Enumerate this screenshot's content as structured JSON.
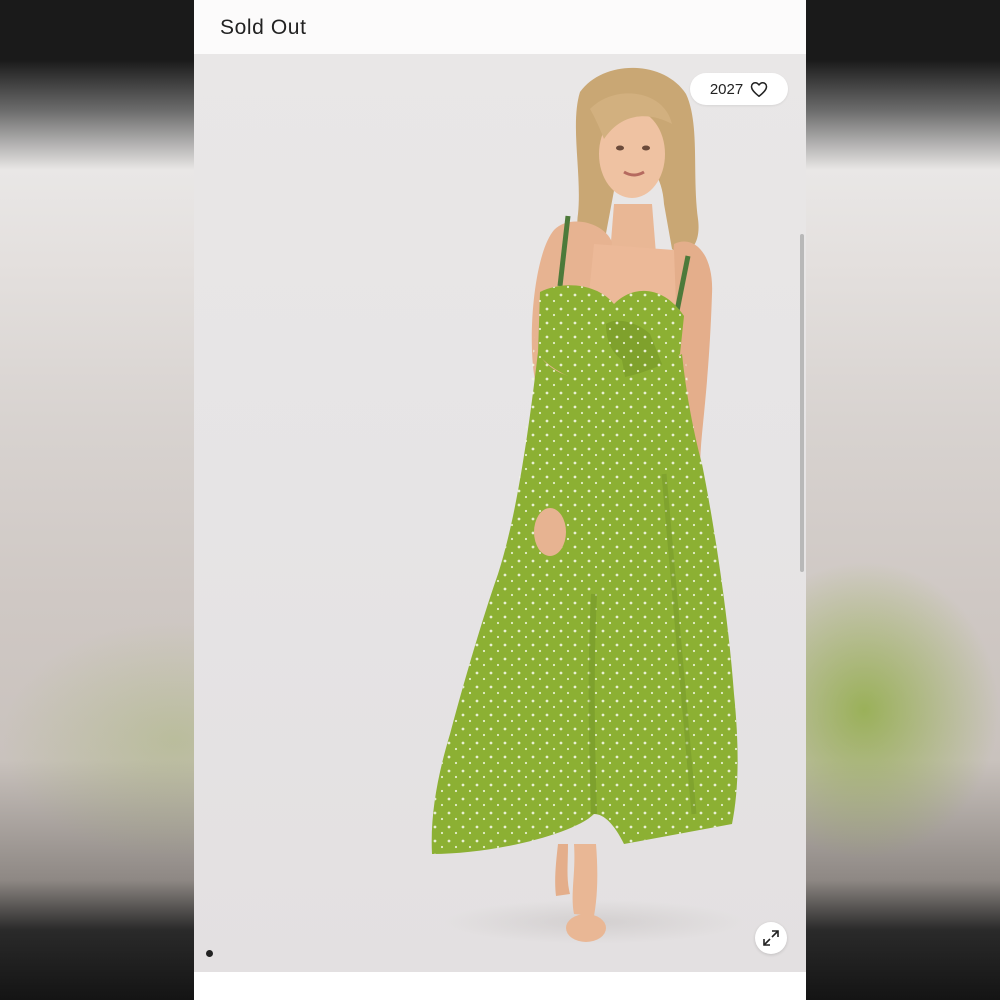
{
  "status": {
    "label": "Sold Out"
  },
  "favorites": {
    "count": "2027",
    "icon": "heart-outline-icon"
  },
  "gallery": {
    "expand_icon": "expand-arrows-icon",
    "dots_count": 1,
    "active_dot": 1
  },
  "colors": {
    "dress_green": "#8cb033",
    "background": "#e7e5e5",
    "text": "#222222"
  }
}
